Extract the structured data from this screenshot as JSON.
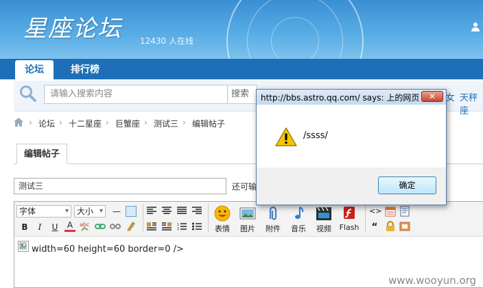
{
  "header": {
    "logo": "星座论坛",
    "online_count": "12430 人在线",
    "user_icon": "user-icon"
  },
  "nav": {
    "tabs": [
      {
        "label": "论坛",
        "active": true
      },
      {
        "label": "排行榜",
        "active": false
      }
    ]
  },
  "search": {
    "placeholder": "请输入搜索内容",
    "select_value": "搜索",
    "side_links": [
      "女",
      "天秤座"
    ]
  },
  "breadcrumb": [
    "论坛",
    "十二星座",
    "巨蟹座",
    "测试三",
    "编辑帖子"
  ],
  "editor": {
    "tab_label": "编辑帖子",
    "title_value": "测试三",
    "title_hint": "还可输",
    "font_select": "字体",
    "size_select": "大小",
    "text_buttons_row1": [
      "—"
    ],
    "text_buttons_row2": [
      "B",
      "I",
      "U",
      "A"
    ],
    "insert_buttons": [
      {
        "label": "表情",
        "icon": "smiley-icon"
      },
      {
        "label": "图片",
        "icon": "picture-icon"
      },
      {
        "label": "附件",
        "icon": "paperclip-icon"
      },
      {
        "label": "音乐",
        "icon": "music-icon"
      },
      {
        "label": "视频",
        "icon": "video-icon"
      },
      {
        "label": "Flash",
        "icon": "flash-icon"
      }
    ],
    "misc_symbols": [
      "<>",
      "“"
    ],
    "content": "width=60 height=60 border=0 />"
  },
  "dialog": {
    "title": "http://bbs.astro.qq.com/ says: 上的网页",
    "message": "/ssss/",
    "ok_label": "确定",
    "close_label": "✕"
  },
  "watermark": "www.wooyun.org",
  "colors": {
    "header_blue": "#3a8fd4",
    "nav_blue": "#1e6fb8",
    "dialog_border": "#5a7ea8"
  }
}
